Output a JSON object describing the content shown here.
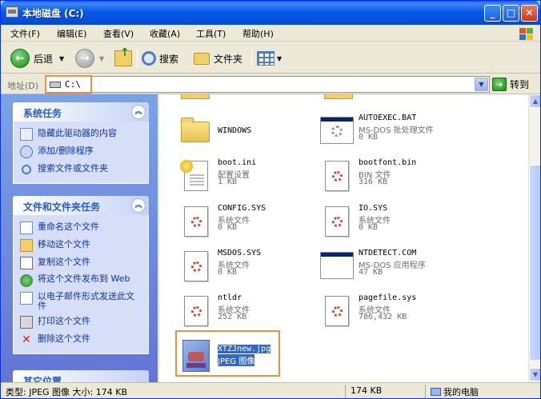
{
  "window": {
    "title": "本地磁盘 (C:)",
    "minimize": "_",
    "maximize": "□",
    "close": "✕"
  },
  "menu": [
    "文件(F)",
    "编辑(E)",
    "查看(V)",
    "收藏(A)",
    "工具(T)",
    "帮助(H)"
  ],
  "toolbar": {
    "back_label": "后退",
    "search_label": "搜索",
    "folders_label": "文件夹"
  },
  "address": {
    "label": "地址(D)",
    "value": "C:\\",
    "go_label": "转到"
  },
  "system_tasks": {
    "title": "系统任务",
    "items": [
      "隐藏此驱动器的内容",
      "添加/删除程序",
      "搜索文件或文件夹"
    ]
  },
  "file_tasks": {
    "title": "文件和文件夹任务",
    "items": [
      "重命名这个文件",
      "移动这个文件",
      "复制这个文件",
      "将这个文件发布到 Web",
      "以电子邮件形式发送此文件",
      "打印这个文件",
      "删除这个文件"
    ]
  },
  "other_places": {
    "title": "其它位置"
  },
  "files": [
    {
      "name": "WINDOWS",
      "type": "",
      "size": "",
      "icon": "folder-icon"
    },
    {
      "name": "AUTOEXEC.BAT",
      "type": "MS-DOS 批处理文件",
      "size": "0 KB",
      "icon": "batch-file-icon"
    },
    {
      "name": "boot.ini",
      "type": "配置设置",
      "size": "1 KB",
      "icon": "config-file-icon"
    },
    {
      "name": "bootfont.bin",
      "type": "BIN 文件",
      "size": "316 KB",
      "icon": "system-file-icon"
    },
    {
      "name": "CONFIG.SYS",
      "type": "系统文件",
      "size": "0 KB",
      "icon": "system-file-icon"
    },
    {
      "name": "IO.SYS",
      "type": "系统文件",
      "size": "0 KB",
      "icon": "system-file-icon"
    },
    {
      "name": "MSDOS.SYS",
      "type": "系统文件",
      "size": "0 KB",
      "icon": "system-file-icon"
    },
    {
      "name": "NTDETECT.COM",
      "type": "MS-DOS 应用程序",
      "size": "47 KB",
      "icon": "dos-app-icon"
    },
    {
      "name": "ntldr",
      "type": "系统文件",
      "size": "252 KB",
      "icon": "system-file-icon"
    },
    {
      "name": "pagefile.sys",
      "type": "系统文件",
      "size": "786,432 KB",
      "icon": "system-file-icon"
    },
    {
      "name": "XTZJnew.jpg",
      "type": "JPEG 图像",
      "size": "",
      "icon": "jpeg-image-icon"
    }
  ],
  "status": {
    "main": "类型: JPEG 图像 大小: 174 KB",
    "size": "174 KB",
    "location": "我的电脑"
  },
  "colors": {
    "titlebar": "#0758e8",
    "taskpane": "#7ba2e7",
    "highlight": "#ef8f43",
    "selection": "#316ac5"
  }
}
